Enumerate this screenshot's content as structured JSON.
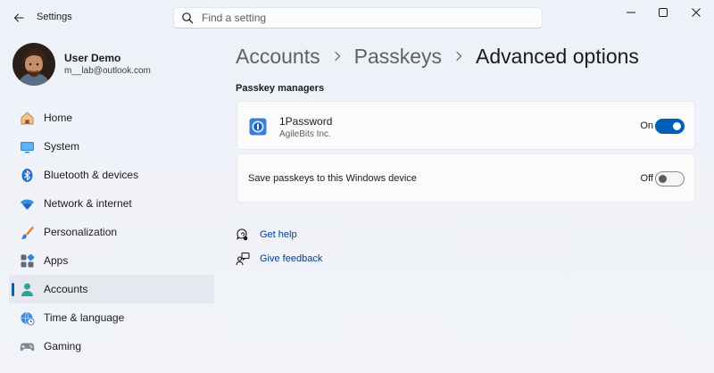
{
  "window": {
    "app_title": "Settings"
  },
  "search": {
    "placeholder": "Find a setting"
  },
  "profile": {
    "name": "User Demo",
    "email": "m__lab@outlook.com"
  },
  "sidebar": {
    "items": [
      {
        "label": "Home",
        "icon": "home-icon",
        "active": false
      },
      {
        "label": "System",
        "icon": "system-icon",
        "active": false
      },
      {
        "label": "Bluetooth & devices",
        "icon": "bluetooth-icon",
        "active": false
      },
      {
        "label": "Network & internet",
        "icon": "wifi-icon",
        "active": false
      },
      {
        "label": "Personalization",
        "icon": "brush-icon",
        "active": false
      },
      {
        "label": "Apps",
        "icon": "apps-icon",
        "active": false
      },
      {
        "label": "Accounts",
        "icon": "accounts-icon",
        "active": true
      },
      {
        "label": "Time & language",
        "icon": "globe-clock-icon",
        "active": false
      },
      {
        "label": "Gaming",
        "icon": "gamepad-icon",
        "active": false
      }
    ]
  },
  "breadcrumb": {
    "items": [
      "Accounts",
      "Passkeys",
      "Advanced options"
    ]
  },
  "main": {
    "section_title": "Passkey managers",
    "cards": [
      {
        "title": "1Password",
        "subtitle": "AgileBits Inc.",
        "state_label": "On",
        "on": true,
        "icon": "1password-icon"
      },
      {
        "title": "Save passkeys to this Windows device",
        "state_label": "Off",
        "on": false
      }
    ],
    "links": [
      {
        "label": "Get help",
        "icon": "help-icon"
      },
      {
        "label": "Give feedback",
        "icon": "feedback-icon"
      }
    ]
  },
  "colors": {
    "accent": "#005fb8",
    "link": "#003e92",
    "background": "#eef2f8",
    "card": "#fbfbfc"
  }
}
